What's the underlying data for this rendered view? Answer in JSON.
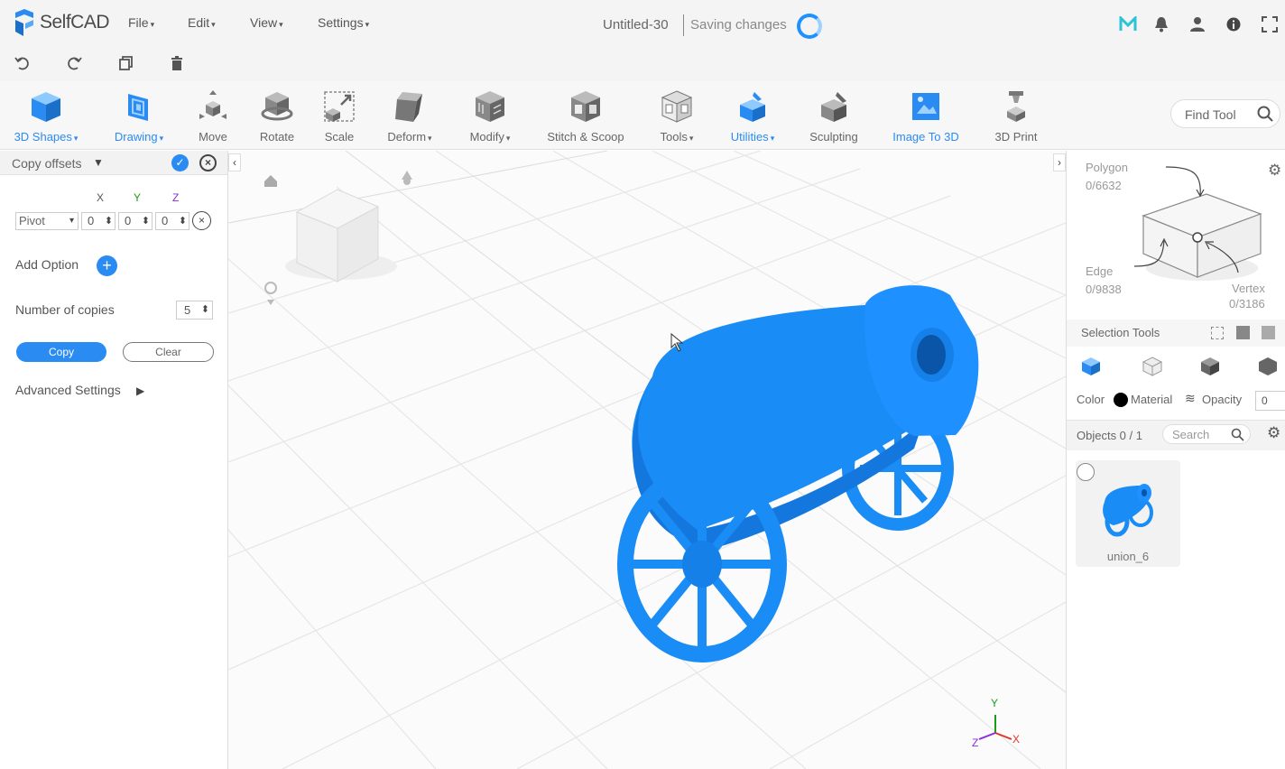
{
  "app": {
    "name": "SelfCAD"
  },
  "menu": {
    "file": "File",
    "edit": "Edit",
    "view": "View",
    "settings": "Settings"
  },
  "document": {
    "title": "Untitled-30",
    "status": "Saving changes"
  },
  "topbar_icons": [
    "m-logo-icon",
    "bell-icon",
    "user-icon",
    "info-icon",
    "fullscreen-icon"
  ],
  "quickbar_icons": [
    "undo-icon",
    "redo-icon",
    "copy-icon",
    "trash-icon"
  ],
  "ribbon": {
    "tools": [
      {
        "label": "3D Shapes",
        "icon": "cube-icon"
      },
      {
        "label": "Drawing",
        "icon": "drawing-icon"
      },
      {
        "label": "Move",
        "icon": "move-icon"
      },
      {
        "label": "Rotate",
        "icon": "rotate-icon"
      },
      {
        "label": "Scale",
        "icon": "scale-icon"
      },
      {
        "label": "Deform",
        "icon": "deform-icon"
      },
      {
        "label": "Modify",
        "icon": "modify-icon"
      },
      {
        "label": "Stitch & Scoop",
        "icon": "stitch-icon"
      },
      {
        "label": "Tools",
        "icon": "tools-icon"
      },
      {
        "label": "Utilities",
        "icon": "utilities-icon"
      },
      {
        "label": "Sculpting",
        "icon": "sculpting-icon"
      },
      {
        "label": "Image To 3D",
        "icon": "image-to-3d-icon"
      },
      {
        "label": "3D Print",
        "icon": "3d-print-icon"
      }
    ],
    "find_tool": "Find Tool"
  },
  "left_panel": {
    "title": "Copy offsets",
    "axes": {
      "x": "X",
      "y": "Y",
      "z": "Z"
    },
    "axis_colors": {
      "x": "#555555",
      "y": "#1a9c1a",
      "z": "#8a2be2"
    },
    "pivot": "Pivot",
    "offsets": {
      "x": "0",
      "y": "0",
      "z": "0"
    },
    "add_option": "Add Option",
    "number_of_copies_label": "Number of copies",
    "number_of_copies": "5",
    "copy_button": "Copy",
    "clear_button": "Clear",
    "advanced_settings": "Advanced Settings"
  },
  "right_panel": {
    "polygon_label": "Polygon",
    "polygon_count": "0/6632",
    "edge_label": "Edge",
    "edge_count": "0/9838",
    "vertex_label": "Vertex",
    "vertex_count": "0/3186",
    "selection_tools": "Selection Tools",
    "color_label": "Color",
    "material_label": "Material",
    "opacity_label": "Opacity",
    "opacity_value": "0",
    "objects_label": "Objects 0 / 1",
    "search_placeholder": "Search",
    "objects": [
      {
        "name": "union_6"
      }
    ]
  },
  "viewport": {
    "axis_labels": {
      "x": "X",
      "y": "Y",
      "z": "Z"
    },
    "model_color": "#1a8cf5"
  },
  "colors": {
    "accent": "#2a8bf2",
    "model": "#1a8cf5"
  }
}
